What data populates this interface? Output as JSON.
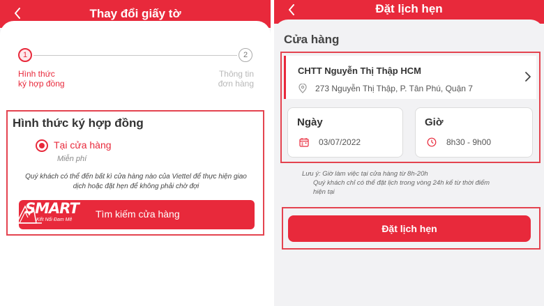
{
  "left": {
    "header_title": "Thay đổi giấy tờ",
    "steps": [
      {
        "number": "1",
        "label_line1": "Hình thức",
        "label_line2": "ký hợp đồng"
      },
      {
        "number": "2",
        "label_line1": "Thông tin",
        "label_line2": "đơn hàng"
      }
    ],
    "section_title": "Hình thức ký hợp đồng",
    "option_label": "Tại cửa hàng",
    "option_fee": "Miễn phí",
    "note_line1": "Quý khách có thể đến bất kì cửa hàng nào của Viettel để thực hiện giao",
    "note_line2": "dịch hoặc đặt hẹn để không phải chờ đợi",
    "find_store_button": "Tìm kiếm cửa hàng",
    "logo_word": "SMART",
    "logo_tagline": "Kết Nối Đam Mê"
  },
  "right": {
    "header_title": "Đặt lịch hẹn",
    "store_heading": "Cửa hàng",
    "store_name": "CHTT Nguyễn Thị Thập HCM",
    "store_address": "273 Nguyễn Thị Thập, P. Tân Phú, Quận 7",
    "date_title": "Ngày",
    "date_value": "03/07/2022",
    "time_title": "Giờ",
    "time_value": "8h30 - 9h00",
    "note_line1": "Lưu ý: Giờ làm việc tại cửa hàng từ 8h-20h",
    "note_line2": "Quý khách chỉ có thể đặt lịch trong vòng 24h kể từ thời điểm",
    "note_line3": "hiện tại",
    "book_button": "Đặt lịch hẹn"
  },
  "colors": {
    "brand_red": "#e8293b",
    "highlight_border": "#e4434f"
  },
  "icons": [
    "back-arrow-icon",
    "location-pin-icon",
    "chevron-right-icon",
    "calendar-icon",
    "clock-icon"
  ]
}
